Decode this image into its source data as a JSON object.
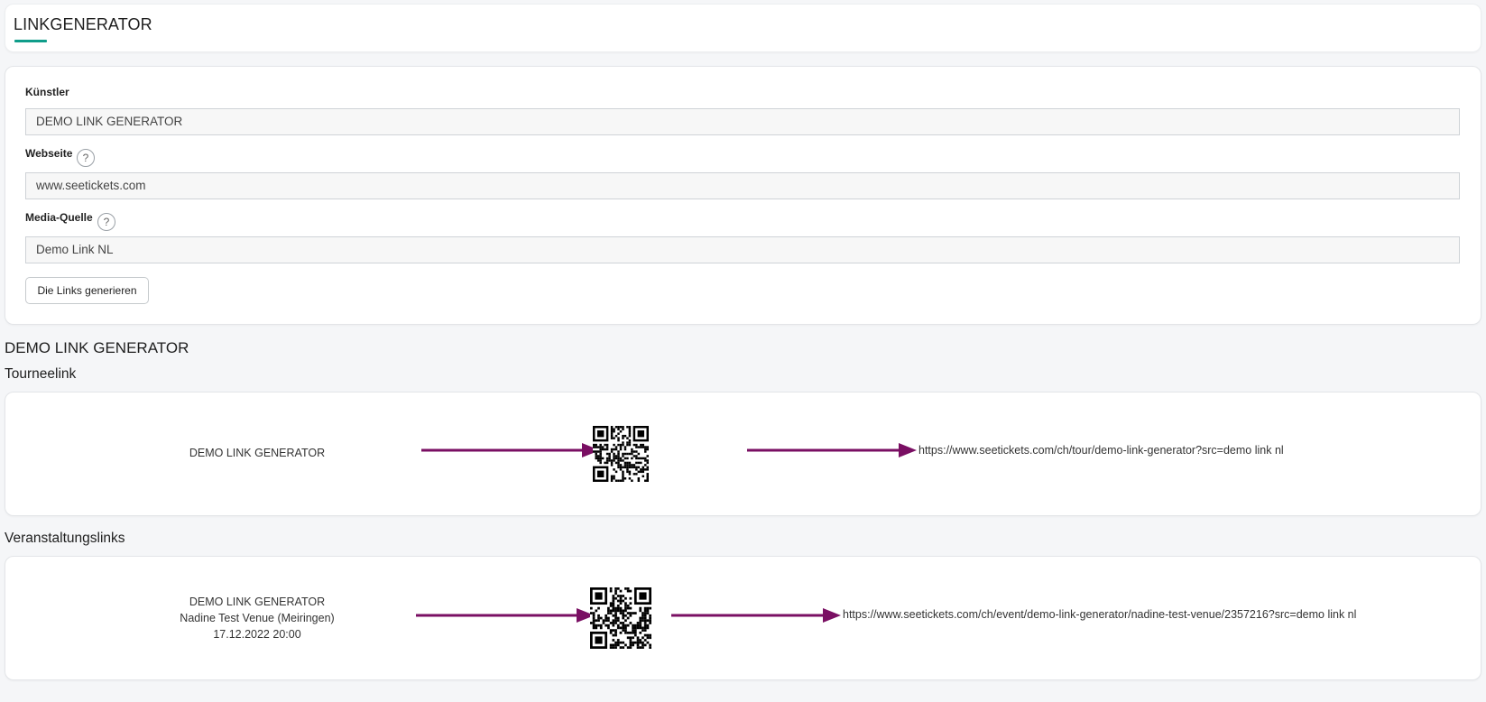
{
  "header": {
    "title": "LINKGENERATOR"
  },
  "form": {
    "artist_label": "Künstler",
    "artist_value": "DEMO LINK GENERATOR",
    "website_label": "Webseite",
    "website_value": "www.seetickets.com",
    "media_label": "Media-Quelle",
    "media_value": "Demo Link NL",
    "help_glyph": "?",
    "generate_button": "Die Links generieren"
  },
  "result": {
    "artist_heading": "DEMO LINK GENERATOR",
    "tour_heading": "Tourneelink",
    "tour": {
      "label": "DEMO LINK GENERATOR",
      "url": "https://www.seetickets.com/ch/tour/demo-link-generator?src=demo link nl"
    },
    "events_heading": "Veranstaltungslinks",
    "event": {
      "name": "DEMO LINK GENERATOR",
      "venue": "Nadine Test Venue (Meiringen)",
      "datetime": "17.12.2022 20:00",
      "url": "https://www.seetickets.com/ch/event/demo-link-generator/nadine-test-venue/2357216?src=demo link nl"
    }
  },
  "colors": {
    "accent": "#0f9d8a",
    "arrow": "#7a0f63"
  },
  "icons": [
    "help-icon",
    "arrow-icon",
    "qr-code-icon"
  ]
}
